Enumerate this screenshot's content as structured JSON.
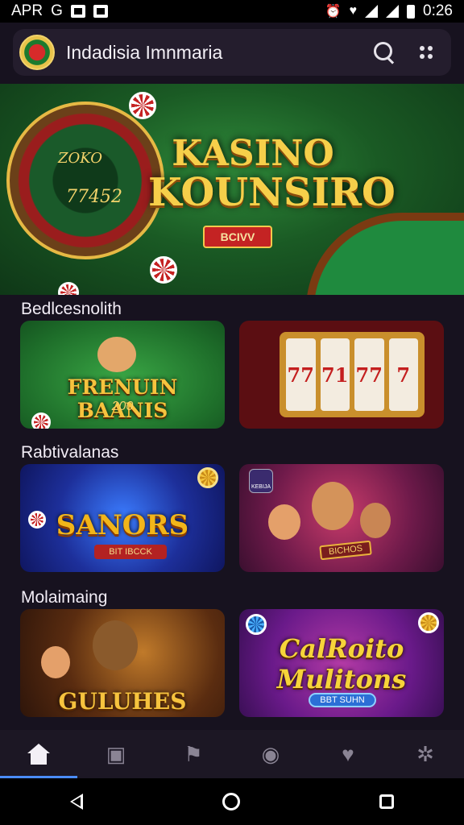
{
  "status_bar": {
    "left_text": "APR",
    "carrier": "G",
    "time": "0:26"
  },
  "app_bar": {
    "title": "Indadisia Imnmaria",
    "search_icon": "search-icon",
    "more_icon": "more-icon"
  },
  "hero": {
    "title_line1": "KASINO",
    "title_line2": "KOUNSIRO",
    "button_label": "BCIVV",
    "wheel_text1": "ZOKO",
    "wheel_text2": "77452"
  },
  "sections": [
    {
      "title": "Bedlcesnolith"
    },
    {
      "title": "Rabtivalanas"
    },
    {
      "title": "Molaimaing"
    }
  ],
  "cards": {
    "c1": {
      "label": "FRENUIN BAANIS",
      "sub": "200"
    },
    "c2": {
      "reel_symbols": [
        "77",
        "71",
        "77",
        "7"
      ]
    },
    "c3": {
      "label": "SANORS",
      "tag": "BIT  IBCCK"
    },
    "c4": {
      "badge": "KEBIJA",
      "sign": "BICHOS"
    },
    "c5": {
      "label": "GULUHES"
    },
    "c6": {
      "label_line1": "CalRoito",
      "label_line2": "Mulitons",
      "button": "BBT  SUHN"
    }
  },
  "bottom_nav": [
    {
      "name": "home",
      "icon": "home-icon",
      "active": true
    },
    {
      "name": "games",
      "icon": "slot-machine-icon",
      "active": false
    },
    {
      "name": "sports",
      "icon": "player-icon",
      "active": false
    },
    {
      "name": "live",
      "icon": "chip-icon",
      "active": false
    },
    {
      "name": "favorites",
      "icon": "heart-icon",
      "active": false
    },
    {
      "name": "settings",
      "icon": "gear-icon",
      "active": false
    }
  ],
  "colors": {
    "background": "#17121f",
    "accent": "#4a8cff",
    "gold": "#f6c33e"
  }
}
